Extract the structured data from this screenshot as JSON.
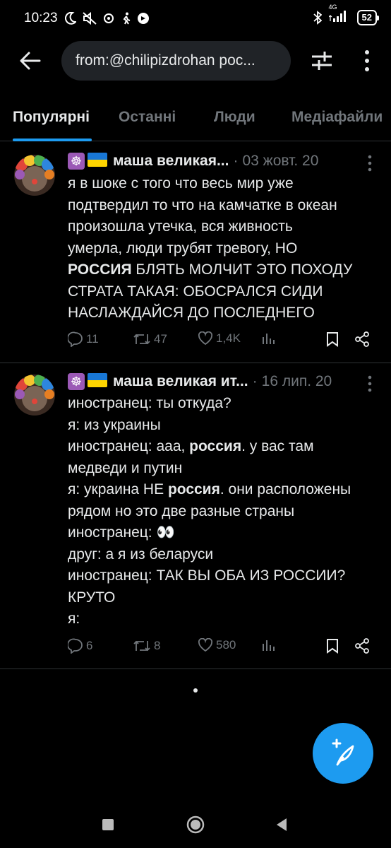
{
  "status_bar": {
    "time": "10:23",
    "network": "4G",
    "battery": "52"
  },
  "header": {
    "search_text": "from:@chilipizdrohan рос..."
  },
  "tabs": [
    {
      "label": "Популярні",
      "active": true
    },
    {
      "label": "Останні",
      "active": false
    },
    {
      "label": "Люди",
      "active": false
    },
    {
      "label": "Медіафайли",
      "active": false
    }
  ],
  "tweets": [
    {
      "author": "маша великая...",
      "date": "03 жовт. 20",
      "lines": [
        "я в шоке с того что весь мир уже",
        "подтвердил то что на камчатке в океан",
        "произошла утечка, вся живность",
        "умерла, люди трубят тревогу, НО",
        "||РОССИЯ|| БЛЯТЬ МОЛЧИТ ЭТО ПОХОДУ",
        "СТРАТА ТАКАЯ: ОБОСРАЛСЯ СИДИ",
        "НАСЛАЖДАЙСЯ ДО ПОСЛЕДНЕГО"
      ],
      "replies": "11",
      "retweets": "47",
      "likes": "1,4K"
    },
    {
      "author": "маша великая ит...",
      "date": "16 лип. 20",
      "lines": [
        "иностранец: ты откуда?",
        "я: из украины",
        "иностранец: ааа, ||россия||. у вас там",
        "медведи и путин",
        "я: украина НЕ ||россия||. они расположены",
        "рядом но это две разные страны",
        "иностранец: 👀",
        "друг: а я из беларуси",
        "иностранец: ТАК ВЫ ОБА ИЗ РОССИИ?",
        "КРУТО",
        "я:"
      ],
      "replies": "6",
      "retweets": "8",
      "likes": "580"
    }
  ],
  "icons": {
    "back": "arrow-left-icon",
    "filter": "sliders-icon",
    "more": "more-vertical-icon",
    "reply": "reply-icon",
    "retweet": "retweet-icon",
    "like": "heart-icon",
    "views": "analytics-icon",
    "bookmark": "bookmark-icon",
    "share": "share-icon",
    "compose": "compose-icon"
  },
  "colors": {
    "accent": "#1d9bf0",
    "background": "#000000",
    "muted": "#71767b"
  }
}
